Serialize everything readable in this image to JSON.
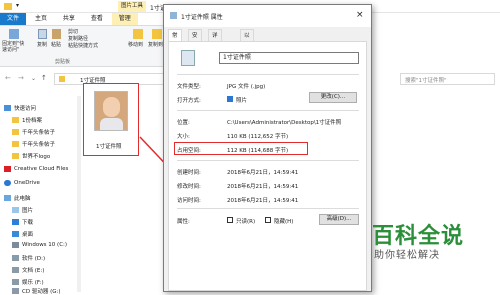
{
  "explorer": {
    "title": "1寸证件照",
    "tabs": [
      "文件",
      "主页",
      "共享",
      "查看",
      "管理"
    ],
    "context_tab": "图片工具",
    "ribbon": {
      "pin": "固定到\"快\n速访问\"",
      "copy": "复制",
      "paste": "粘贴",
      "cut": "剪切",
      "copy_path": "复制路径",
      "paste_shortcut": "粘贴快捷方式",
      "move_to": "移动到",
      "copy_to": "复制到",
      "group": "剪贴板"
    },
    "breadcrumb": "1寸证件照",
    "search_placeholder": "搜索\"1寸证件照\"",
    "nav": [
      "快速访问",
      "1份档案",
      "千年头条帖子",
      "千年头条帖子",
      "世界不logo",
      "Creative Cloud Files",
      "OneDrive",
      "此电脑",
      "图片",
      "下载",
      "桌面",
      "Windows 10 (C:)",
      "软件 (D:)",
      "文档 (E:)",
      "娱乐 (F:)",
      "CD 驱动器 (G:)"
    ],
    "file_label": "1寸证件照"
  },
  "dialog": {
    "title": "1寸证件照 属性",
    "close": "×",
    "tabs": [
      "常规",
      "安全",
      "详细信息",
      "以前的版本"
    ],
    "filename": "1寸证件照",
    "rows": {
      "type_label": "文件类型:",
      "type_value": "JPG 文件 (.jpg)",
      "open_label": "打开方式:",
      "open_value": "照片",
      "change_btn": "更改(C)...",
      "loc_label": "位置:",
      "loc_value": "C:\\Users\\Administrator\\Desktop\\1寸证件照",
      "size_label": "大小:",
      "size_value": "110 KB (112,652 字节)",
      "disk_label": "占用空间:",
      "disk_value": "112 KB (114,688 字节)",
      "created_label": "创建时间:",
      "created_value": "2018年6月21日，14:59:41",
      "modified_label": "修改时间:",
      "modified_value": "2018年6月21日，14:59:41",
      "accessed_label": "访问时间:",
      "accessed_value": "2018年6月21日，14:59:41",
      "attr_label": "属性:",
      "readonly": "只读(R)",
      "hidden": "隐藏(H)",
      "advanced_btn": "高级(D)..."
    }
  },
  "watermark": {
    "line1": "百科全说",
    "line2": "助你轻松解决"
  },
  "colors": {
    "red": "#e32c2c",
    "accent": "#0078d7",
    "folder": "#f3c43f"
  }
}
